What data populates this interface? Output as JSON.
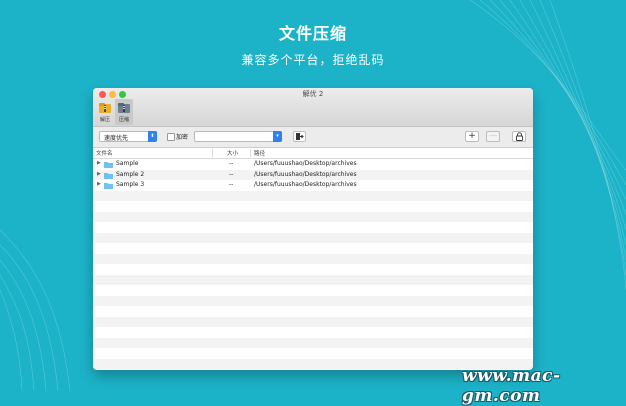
{
  "hero": {
    "title": "文件压缩",
    "subtitle": "兼容多个平台，拒绝乱码"
  },
  "window": {
    "title": "解优 2",
    "traffic_lights": [
      "#fc5753",
      "#fdbc40",
      "#33c748"
    ],
    "toolbar": [
      {
        "label": "解压",
        "icon": "extract-icon",
        "active": false
      },
      {
        "label": "压缩",
        "icon": "compress-icon",
        "active": true
      }
    ],
    "options": {
      "mode_value": "速度优先",
      "encrypt_label": "加密",
      "encrypt_checked": false,
      "password_value": "",
      "add_button": "+",
      "remove_button": "—"
    },
    "columns": {
      "name": "文件名",
      "size": "大小",
      "path": "路径"
    },
    "rows": [
      {
        "name": "Sample",
        "size": "--",
        "path": "/Users/fuuushao/Desktop/archives"
      },
      {
        "name": "Sample 2",
        "size": "--",
        "path": "/Users/fuuushao/Desktop/archives"
      },
      {
        "name": "Sample 3",
        "size": "--",
        "path": "/Users/fuuushao/Desktop/archives"
      }
    ]
  },
  "watermark": "www.mac-gm.com",
  "colors": {
    "background": "#1cb3c9",
    "accent": "#2f80f1",
    "folder": "#6fc2ee"
  }
}
